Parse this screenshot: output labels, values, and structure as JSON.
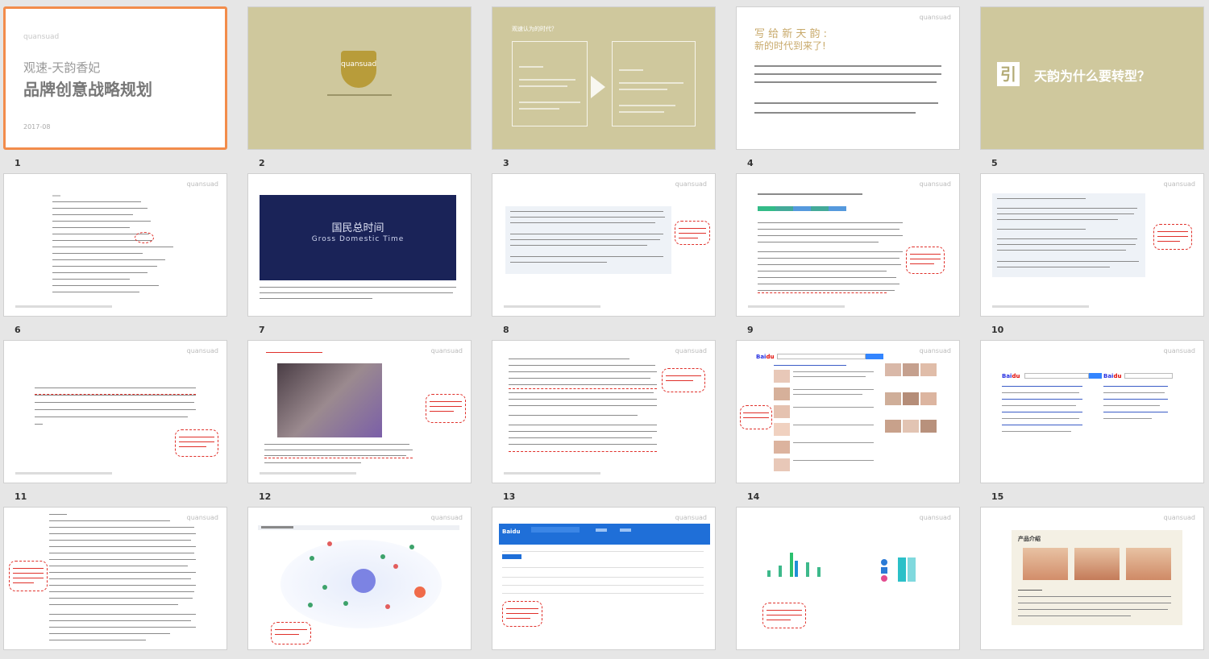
{
  "slides": [
    {
      "number": "1",
      "logo": "quansuad",
      "title_line1": "观速-天韵香妃",
      "title_line2": "品牌创意战略规划",
      "date": "2017-08",
      "selected": true
    },
    {
      "number": "2",
      "logo": "quansuad"
    },
    {
      "number": "3",
      "heading": "观速认为的时代？"
    },
    {
      "number": "4",
      "title_line1": "写 给 新 天 韵 :",
      "title_line2": "新的时代到来了!",
      "logo": "quansuad"
    },
    {
      "number": "5",
      "yin": "引",
      "question": "天韵为什么要转型？"
    },
    {
      "number": "6",
      "logo": "quansuad"
    },
    {
      "number": "7",
      "logo": "quansuad",
      "image_title_cn": "国民总时间",
      "image_title_en": "Gross  Domestic  Time"
    },
    {
      "number": "8",
      "logo": "quansuad"
    },
    {
      "number": "9",
      "logo": "quansuad"
    },
    {
      "number": "10",
      "logo": "quansuad"
    },
    {
      "number": "11",
      "logo": "quansuad"
    },
    {
      "number": "12",
      "logo": "quansuad"
    },
    {
      "number": "13",
      "logo": "quansuad"
    },
    {
      "number": "14",
      "logo": "quansuad"
    },
    {
      "number": "15",
      "logo": "quansuad"
    },
    {
      "number": "",
      "logo": "quansuad"
    },
    {
      "number": "",
      "logo": "quansuad"
    },
    {
      "number": "",
      "logo": "quansuad"
    },
    {
      "number": "",
      "logo": "quansuad"
    },
    {
      "number": "",
      "logo": "quansuad",
      "section": "产品介绍"
    }
  ],
  "colors": {
    "beige": "#cfc89d",
    "selected_border": "#f28c4b",
    "annotation_red": "#e0302a",
    "dark_blue": "#1a2358"
  }
}
